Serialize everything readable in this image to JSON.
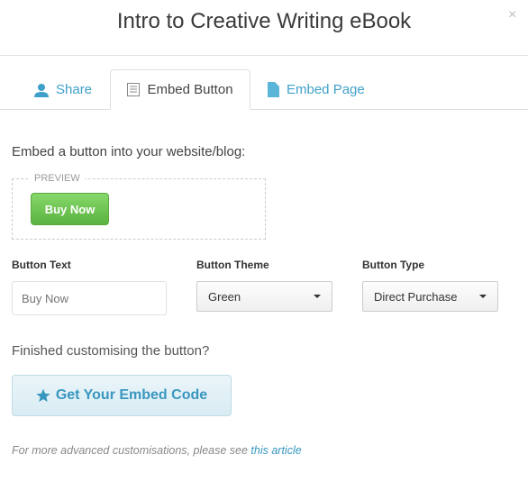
{
  "dialog": {
    "title": "Intro to Creative Writing eBook",
    "close": "×"
  },
  "tabs": [
    {
      "label": "Share",
      "icon": "user-icon",
      "active": false
    },
    {
      "label": "Embed Button",
      "icon": "list-icon",
      "active": true
    },
    {
      "label": "Embed Page",
      "icon": "document-icon",
      "active": false
    }
  ],
  "main": {
    "lead": "Embed a button into your website/blog:",
    "preview_label": "PREVIEW",
    "preview_button": "Buy Now",
    "fields": {
      "text_label": "Button Text",
      "text_value": "",
      "text_placeholder": "Buy Now",
      "theme_label": "Button Theme",
      "theme_value": "Green",
      "type_label": "Button Type",
      "type_value": "Direct Purchase"
    },
    "finished": "Finished customising the button?",
    "embed_button": "Get Your Embed Code",
    "footer_text": "For more advanced customisations, please see ",
    "footer_link": "this article"
  },
  "colors": {
    "accent": "#3fa0c9",
    "buy_green": "#5bb33f"
  }
}
